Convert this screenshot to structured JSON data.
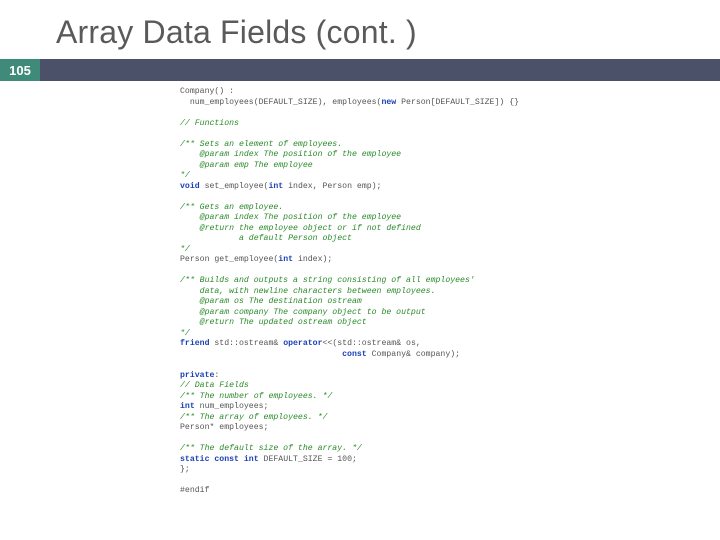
{
  "title": "Array Data Fields (cont. )",
  "page_number": "105",
  "code": {
    "l01": "Company() :",
    "l02": "  num_employees(DEFAULT_SIZE), employees(",
    "l03": "// Functions",
    "l04": "/** Sets an element of employees.",
    "l05": "    @param index The position of the employee",
    "l06": "    @param emp The employee",
    "l07": "*/",
    "l08": "    @param index The position of the employee",
    "l09": "    @return the employee object or if not defined",
    "l10": "            a default Person object",
    "l11": "*/",
    "l12": "Person get_employee(",
    "l13": "/** Builds and outputs a string consisting of all employees'",
    "l14": "    data, with newline characters between employees.",
    "l15": "    @param os The destination ostream",
    "l16": "    @param company The company object to be output",
    "l17": "    @return The updated ostream object",
    "l18": "*/",
    "l19": "                                 const",
    "priv": "private",
    "l20": "// Data Fields",
    "l21": "/** The number of employees. */",
    "l22": "/** The array of employees. */",
    "l23": "Person* employees;",
    "l24": "/** The default size of the array. */",
    "l25": "};",
    "l26": "#endif",
    "kw_new": "new",
    "t_person_arr": " Person[DEFAULT_SIZE]) {}",
    "kw_void": "void",
    "t_set": " set_employee(",
    "kw_int1": "int",
    "t_idx_person": " index, Person emp);",
    "cm_gets": "/** Gets an employee.",
    "kw_int2": "int",
    "t_idx_close": " index);",
    "kw_friend": "friend",
    "t_ostream": " std::ostream& ",
    "kw_op": "operator",
    "t_opsig": "<<(std::ostream& os,",
    "t_company_ref": " Company& company);",
    "t_colon": ":",
    "kw_int3": "int",
    "t_numemp": " num_employees;",
    "kw_static": "static",
    "kw_const2": " const",
    "kw_int4": " int",
    "t_default": " DEFAULT_SIZE = 100;"
  }
}
